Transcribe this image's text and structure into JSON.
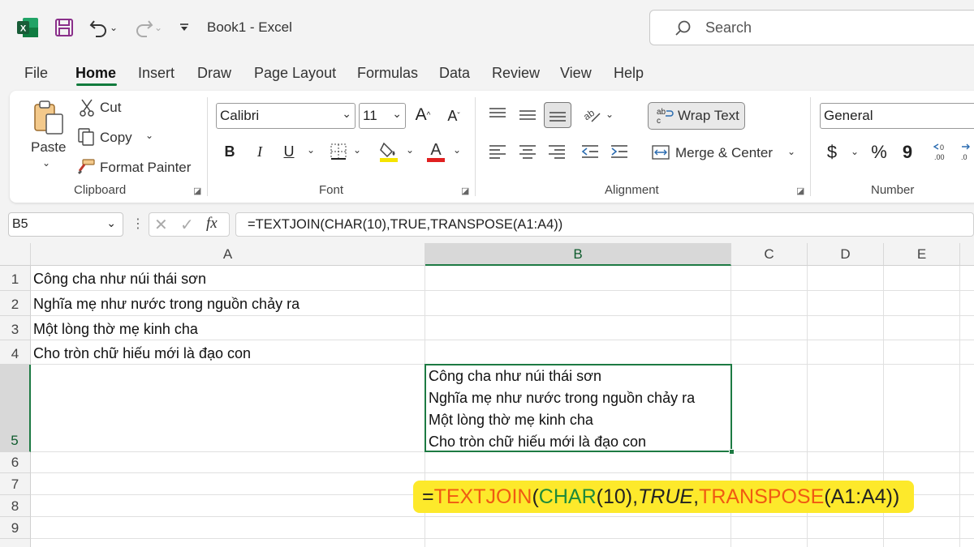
{
  "colors": {
    "accent_green": "#1d7a43",
    "callout_bg": "#fde92b",
    "fn_orange": "#f05a12",
    "fn_green": "#1e8a3a",
    "highlight_yellow": "#f5e400",
    "font_red": "#e02020"
  },
  "titlebar": {
    "title": "Book1  -  Excel",
    "icons": [
      "excel-logo-icon",
      "save-icon",
      "undo-icon",
      "redo-icon",
      "customize-toolbar-icon"
    ],
    "search_placeholder": "Search"
  },
  "menu": {
    "tabs": [
      "File",
      "Home",
      "Insert",
      "Draw",
      "Page Layout",
      "Formulas",
      "Data",
      "Review",
      "View",
      "Help"
    ],
    "active": "Home"
  },
  "ribbon": {
    "clipboard": {
      "label": "Clipboard",
      "paste": "Paste",
      "cut": "Cut",
      "copy": "Copy",
      "format_painter": "Format Painter"
    },
    "font": {
      "label": "Font",
      "name": "Calibri",
      "size": "11",
      "bold": "B",
      "italic": "I",
      "underline": "U"
    },
    "alignment": {
      "label": "Alignment",
      "wrap_text": "Wrap Text",
      "merge_center": "Merge & Center"
    },
    "number": {
      "label": "Number",
      "format": "General",
      "currency": "$",
      "percent": "%",
      "comma": "9"
    }
  },
  "formula_bar": {
    "name_box": "B5",
    "fx": "fx",
    "formula": "=TEXTJOIN(CHAR(10),TRUE,TRANSPOSE(A1:A4))"
  },
  "sheet": {
    "columns": [
      "A",
      "B",
      "C",
      "D",
      "E"
    ],
    "rows": [
      "1",
      "2",
      "3",
      "4",
      "5",
      "6",
      "7",
      "8",
      "9"
    ],
    "selected_cell": "B5",
    "cells": {
      "A1": "Công cha như núi thái sơn",
      "A2": "Nghĩa mẹ như nước trong nguồn chảy ra",
      "A3": "Một lòng thờ mẹ kinh cha",
      "A4": "Cho tròn chữ hiếu mới là đạo con"
    },
    "B5_lines": [
      "Công cha như núi thái sơn",
      "Nghĩa mẹ như nước trong nguồn chảy ra",
      "Một lòng thờ mẹ kinh cha",
      "Cho tròn chữ hiếu mới là đạo con"
    ]
  },
  "callout": {
    "parts": [
      {
        "text": "=",
        "role": "plain"
      },
      {
        "text": "TEXTJOIN",
        "role": "fn-orange"
      },
      {
        "text": "(",
        "role": "plain"
      },
      {
        "text": "CHAR",
        "role": "fn-green"
      },
      {
        "text": "(10),",
        "role": "plain"
      },
      {
        "text": "TRUE",
        "role": "italic"
      },
      {
        "text": ",",
        "role": "plain"
      },
      {
        "text": "TRANSPOSE",
        "role": "fn-orange"
      },
      {
        "text": "(A1:A4))",
        "role": "plain"
      }
    ]
  }
}
